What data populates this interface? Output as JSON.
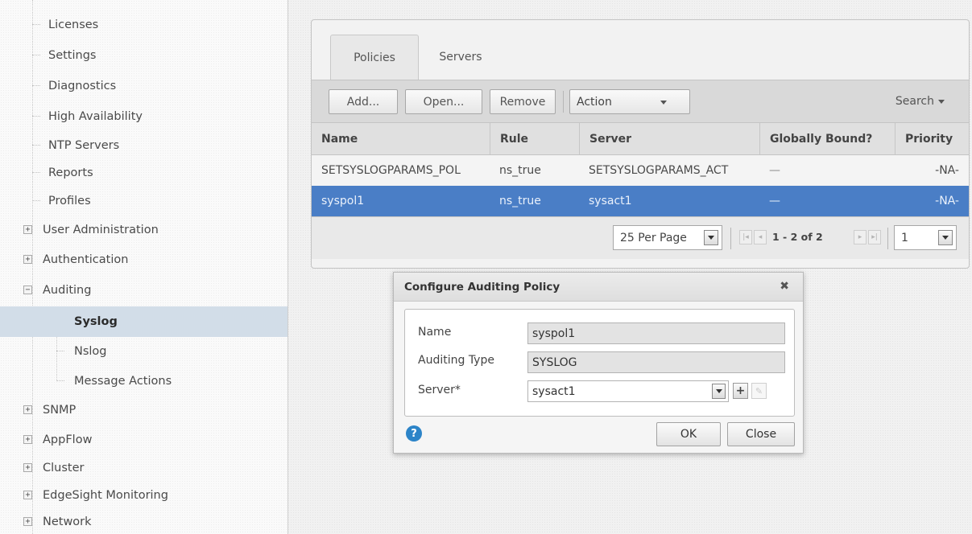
{
  "sidebar": {
    "items": [
      {
        "label": "Licenses",
        "type": "leaf"
      },
      {
        "label": "Settings",
        "type": "leaf"
      },
      {
        "label": "Diagnostics",
        "type": "leaf"
      },
      {
        "label": "High Availability",
        "type": "leaf"
      },
      {
        "label": "NTP Servers",
        "type": "leaf"
      },
      {
        "label": "Reports",
        "type": "leaf"
      },
      {
        "label": "Profiles",
        "type": "leaf"
      },
      {
        "label": "User Administration",
        "type": "collapsed"
      },
      {
        "label": "Authentication",
        "type": "collapsed"
      },
      {
        "label": "Auditing",
        "type": "expanded"
      },
      {
        "label": "Syslog",
        "type": "child",
        "selected": true
      },
      {
        "label": "Nslog",
        "type": "child"
      },
      {
        "label": "Message Actions",
        "type": "child"
      },
      {
        "label": "SNMP",
        "type": "collapsed"
      },
      {
        "label": "AppFlow",
        "type": "collapsed"
      },
      {
        "label": "Cluster",
        "type": "collapsed"
      },
      {
        "label": "EdgeSight Monitoring",
        "type": "collapsed"
      },
      {
        "label": "Network",
        "type": "collapsed"
      }
    ]
  },
  "tabs": [
    {
      "label": "Policies",
      "active": true
    },
    {
      "label": "Servers",
      "active": false
    }
  ],
  "toolbar": {
    "add_label": "Add...",
    "open_label": "Open...",
    "remove_label": "Remove",
    "action_label": "Action",
    "search_label": "Search"
  },
  "table": {
    "columns": [
      "Name",
      "Rule",
      "Server",
      "Globally Bound?",
      "Priority"
    ],
    "rows": [
      {
        "name": "SETSYSLOGPARAMS_POL",
        "rule": "ns_true",
        "server": "SETSYSLOGPARAMS_ACT",
        "globally_bound": "—",
        "priority": "-NA-",
        "selected": false
      },
      {
        "name": "syspol1",
        "rule": "ns_true",
        "server": "sysact1",
        "globally_bound": "—",
        "priority": "-NA-",
        "selected": true
      }
    ]
  },
  "pager": {
    "per_page": "25 Per Page",
    "range": "1 - 2 of 2",
    "page": "1"
  },
  "dialog": {
    "title": "Configure Auditing Policy",
    "close_glyph": "✖",
    "fields": {
      "name_label": "Name",
      "name_value": "syspol1",
      "type_label": "Auditing Type",
      "type_value": "SYSLOG",
      "server_label": "Server*",
      "server_value": "sysact1"
    },
    "ok_label": "OK",
    "close_label": "Close",
    "help_glyph": "?"
  },
  "colors": {
    "selected_row": "#4a7ec6",
    "selected_nav": "#d2dde8",
    "help_icon": "#2c84c8"
  }
}
